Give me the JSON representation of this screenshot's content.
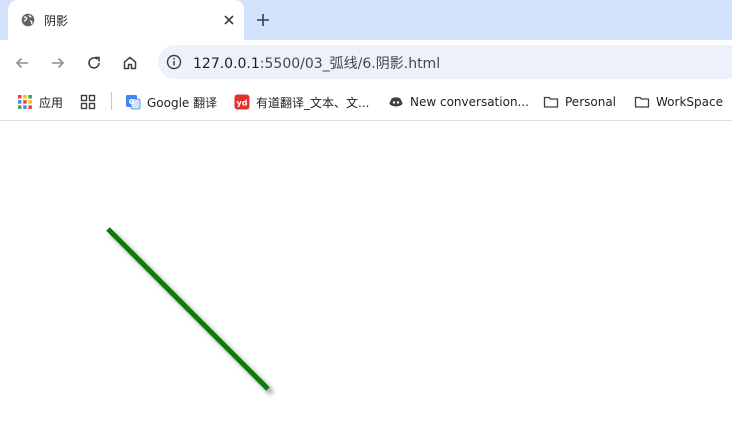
{
  "tab": {
    "title": "阴影"
  },
  "toolbar": {
    "url_host": "127.0.0.1",
    "url_path": ":5500/03_弧线/6.阴影.html"
  },
  "bookmarks": [
    {
      "label": "应用",
      "icon": "apps-grid-icon"
    },
    {
      "label": "",
      "icon": "tab-groups-icon"
    },
    {
      "label": "Google 翻译",
      "icon": "google-translate-icon"
    },
    {
      "label": "有道翻译_文本、文...",
      "icon": "youdao-icon"
    },
    {
      "label": "New conversation...",
      "icon": "copilot-icon"
    },
    {
      "label": "Personal",
      "icon": "folder-icon"
    },
    {
      "label": "WorkSpace",
      "icon": "folder-icon"
    }
  ],
  "canvas": {
    "line_color": "#0b7a0b",
    "shadow_color": "#9a9a9a"
  }
}
